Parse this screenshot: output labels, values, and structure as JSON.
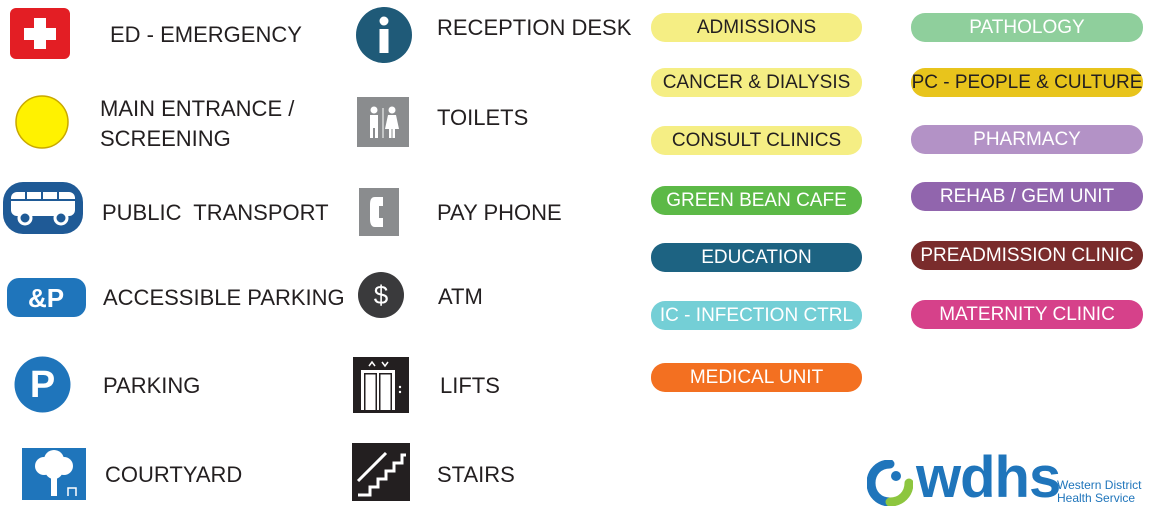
{
  "legend": {
    "col1": [
      {
        "id": "ed",
        "label": "ED - EMERGENCY",
        "icon": "first-aid-cross-icon",
        "color": "#e31e24"
      },
      {
        "id": "main",
        "label_line1": "MAIN ENTRANCE /",
        "label_line2": "SCREENING",
        "icon": "yellow-circle-icon",
        "color": "#fff200"
      },
      {
        "id": "transport",
        "label": "PUBLIC  TRANSPORT",
        "icon": "bus-icon",
        "color": "#1f5a96"
      },
      {
        "id": "accessible",
        "label": "ACCESSIBLE PARKING",
        "icon": "accessible-parking-icon",
        "color": "#1f75bb"
      },
      {
        "id": "parking",
        "label": "PARKING",
        "icon": "parking-icon",
        "color": "#1f75bb"
      },
      {
        "id": "courtyard",
        "label": "COURTYARD",
        "icon": "tree-icon",
        "color": "#1f75bb"
      }
    ],
    "col2": [
      {
        "id": "reception",
        "label": "RECEPTION DESK",
        "icon": "info-icon",
        "color": "#1f5a78"
      },
      {
        "id": "toilets",
        "label": "TOILETS",
        "icon": "toilets-icon",
        "color": "#8a8c8e"
      },
      {
        "id": "phone",
        "label": "PAY PHONE",
        "icon": "phone-icon",
        "color": "#8a8c8e"
      },
      {
        "id": "atm",
        "label": "ATM",
        "icon": "dollar-icon",
        "color": "#3a3a3c"
      },
      {
        "id": "lifts",
        "label": "LIFTS",
        "icon": "lift-icon",
        "color": "#231f20"
      },
      {
        "id": "stairs",
        "label": "STAIRS",
        "icon": "stairs-icon",
        "color": "#231f20"
      }
    ]
  },
  "departments": {
    "col1": [
      {
        "label": "ADMISSIONS",
        "bg": "#f5ee84",
        "fg": "#231f20"
      },
      {
        "label": "CANCER & DIALYSIS",
        "bg": "#f5ee84",
        "fg": "#231f20"
      },
      {
        "label": "CONSULT CLINICS",
        "bg": "#f5ee84",
        "fg": "#231f20"
      },
      {
        "label": "GREEN BEAN CAFE",
        "bg": "#5cb947",
        "fg": "#ffffff"
      },
      {
        "label": "EDUCATION",
        "bg": "#1d6382",
        "fg": "#ffffff"
      },
      {
        "label": "IC - INFECTION CTRL",
        "bg": "#74cfd6",
        "fg": "#ffffff"
      },
      {
        "label": "MEDICAL UNIT",
        "bg": "#f37021",
        "fg": "#ffffff"
      }
    ],
    "col2": [
      {
        "label": "PATHOLOGY",
        "bg": "#8fcf9c",
        "fg": "#ffffff"
      },
      {
        "label": "PC - PEOPLE & CULTURE",
        "bg": "#e8c41c",
        "fg": "#231f20"
      },
      {
        "label": "PHARMACY",
        "bg": "#b392c6",
        "fg": "#ffffff"
      },
      {
        "label": "REHAB / GEM UNIT",
        "bg": "#9165ad",
        "fg": "#ffffff"
      },
      {
        "label": "PREADMISSION CLINIC",
        "bg": "#7a2c2c",
        "fg": "#ffffff"
      },
      {
        "label": "MATERNITY CLINIC",
        "bg": "#d6418a",
        "fg": "#ffffff"
      }
    ]
  },
  "logo": {
    "wordmark": "wdhs",
    "line1": "Western District",
    "line2": "Health Service",
    "color": "#1f75bb",
    "accent": "#8dc63f"
  }
}
